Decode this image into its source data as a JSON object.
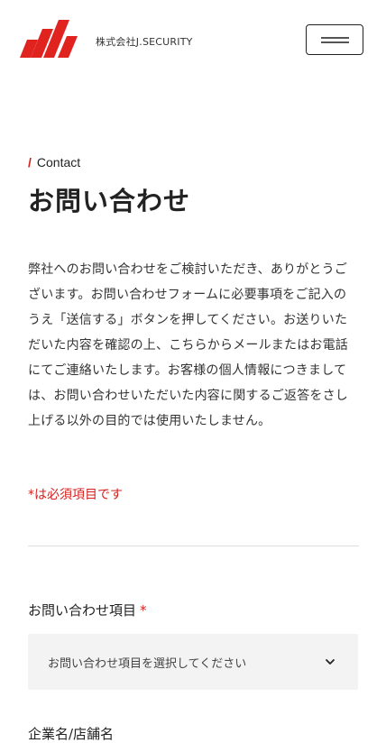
{
  "header": {
    "company_name": "株式会社J.SECURITY",
    "logo_icon": "brand-stripes-logo",
    "menu_icon": "hamburger-menu-icon"
  },
  "contact": {
    "eyebrow_slash": "/",
    "eyebrow": "Contact",
    "title": "お問い合わせ",
    "intro": "弊社へのお問い合わせをご検討いただき、ありがとうございます。お問い合わせフォームに必要事項をご記入のうえ「送信する」ボタンを押してください。お送りいただいた内容を確認の上、こちらからメールまたはお電話にてご連絡いたします。お客様の個人情報につきましては、お問い合わせいただいた内容に関するご返答をさし上げる以外の目的では使用いたしません。",
    "required_note": "*は必須項目です"
  },
  "form": {
    "inquiry_type": {
      "label": "お問い合わせ項目",
      "required_mark": "*",
      "selected": "お問い合わせ項目を選択してください"
    },
    "company_name": {
      "label": "企業名/店舗名"
    }
  },
  "colors": {
    "accent": "#d6201d",
    "text": "#222222",
    "select_bg": "#f3f3f3",
    "divider": "#dddddd"
  }
}
